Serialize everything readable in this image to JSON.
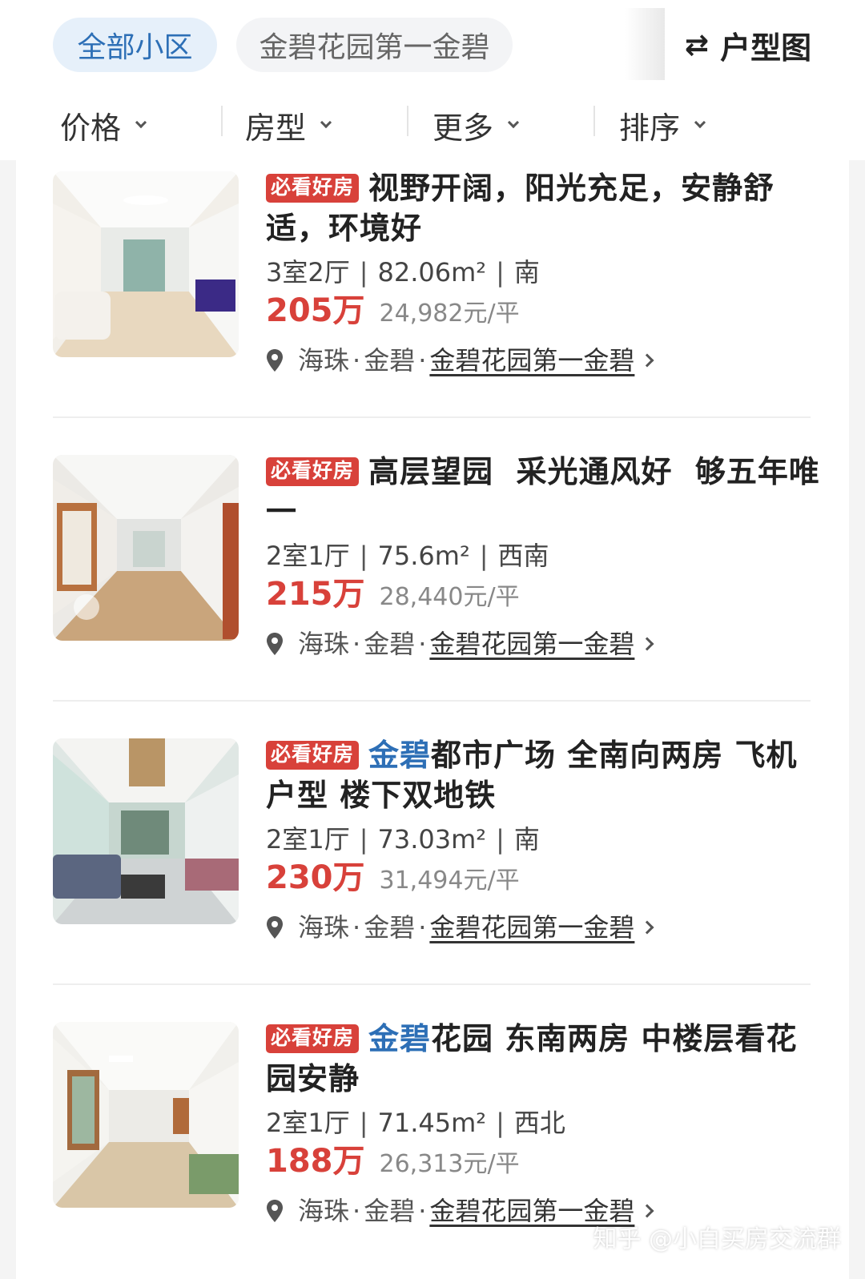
{
  "header": {
    "tab_all": "全部小区",
    "tab_community": "金碧花园第一金碧",
    "layout_label": "户型图",
    "layout_icon": "swap-arrows-icon"
  },
  "filters": [
    {
      "label": "价格"
    },
    {
      "label": "房型"
    },
    {
      "label": "更多"
    },
    {
      "label": "排序"
    }
  ],
  "listings": [
    {
      "badge": "必看好房",
      "title_highlight": "",
      "title": "视野开阔，阳光充足，安静舒适，环境好",
      "layout": "3室2厅",
      "area": "82.06m²",
      "orientation": "南",
      "price": "205万",
      "unit_price": "24,982元/平",
      "district": "海珠",
      "area_name": "金碧",
      "community": "金碧花园第一金碧"
    },
    {
      "badge": "必看好房",
      "title_highlight": "",
      "title": "高层望园  采光通风好  够五年唯一",
      "layout": "2室1厅",
      "area": "75.6m²",
      "orientation": "西南",
      "price": "215万",
      "unit_price": "28,440元/平",
      "district": "海珠",
      "area_name": "金碧",
      "community": "金碧花园第一金碧"
    },
    {
      "badge": "必看好房",
      "title_highlight": "金碧",
      "title": "都市广场 全南向两房 飞机户型 楼下双地铁",
      "layout": "2室1厅",
      "area": "73.03m²",
      "orientation": "南",
      "price": "230万",
      "unit_price": "31,494元/平",
      "district": "海珠",
      "area_name": "金碧",
      "community": "金碧花园第一金碧"
    },
    {
      "badge": "必看好房",
      "title_highlight": "金碧",
      "title": "花园 东南两房 中楼层看花园安静",
      "layout": "2室1厅",
      "area": "71.45m²",
      "orientation": "西北",
      "price": "188万",
      "unit_price": "26,313元/平",
      "district": "海珠",
      "area_name": "金碧",
      "community": "金碧花园第一金碧"
    }
  ],
  "watermark": "知乎 @小白买房交流群",
  "colors": {
    "accent_blue": "#2d6fb6",
    "price_red": "#d8413a"
  }
}
